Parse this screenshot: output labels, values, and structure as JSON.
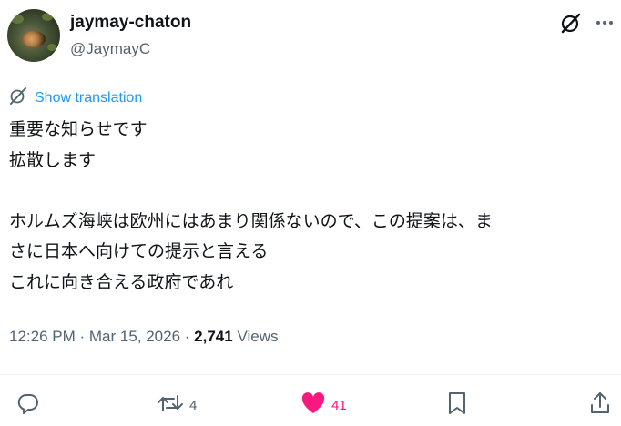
{
  "author": {
    "display_name": "jaymay-chaton",
    "handle": "@JaymayC"
  },
  "icons": {
    "grok": "grok-icon",
    "more": "more-icon",
    "translate": "translate-icon",
    "reply": "reply-icon",
    "retweet": "retweet-icon",
    "like": "heart-icon",
    "bookmark": "bookmark-icon",
    "share": "share-icon"
  },
  "translation": {
    "label": "Show translation"
  },
  "tweet": {
    "lines": [
      "重要な知らせです",
      "拡散します",
      "",
      "ホルムズ海峡は欧州にはあまり関係ないので、この提案は、ま",
      "さに日本へ向けての提示と言える",
      "これに向き合える政府であれ"
    ]
  },
  "meta": {
    "time": "12:26 PM",
    "separator": " · ",
    "date": "Mar 15, 2026",
    "views_count": "2,741",
    "views_label": " Views"
  },
  "actions": {
    "retweets": "4",
    "likes": "41"
  },
  "colors": {
    "text": "#0f1419",
    "secondary": "#536471",
    "link": "#1d9bf0",
    "like": "#f91880",
    "divider": "#eff3f4"
  }
}
